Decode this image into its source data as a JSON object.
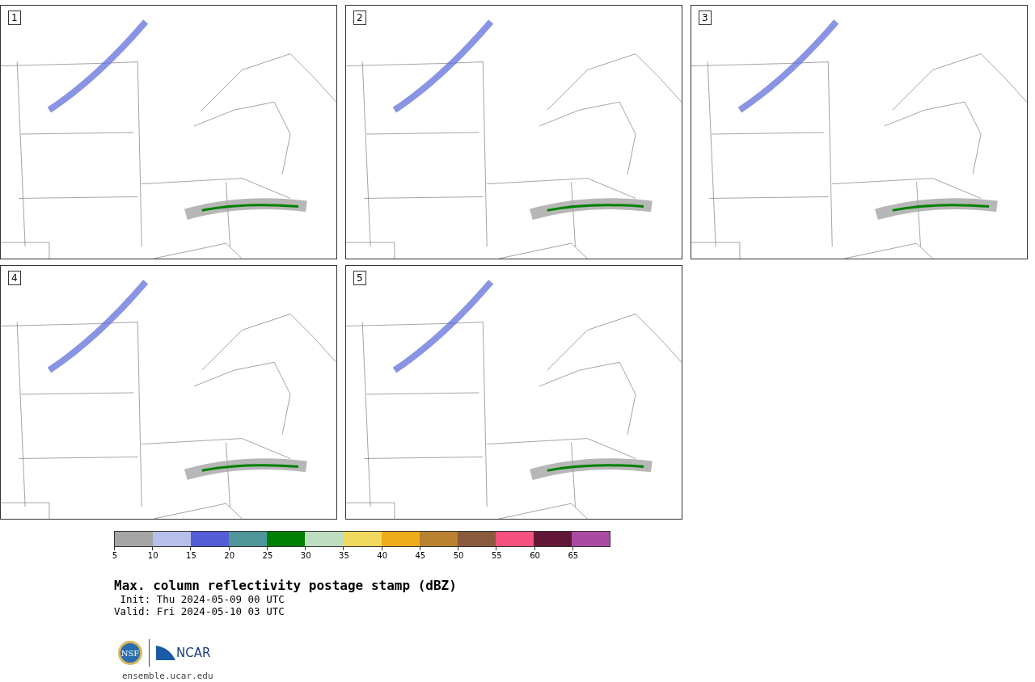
{
  "panels": [
    {
      "label": "1"
    },
    {
      "label": "2"
    },
    {
      "label": "3"
    },
    {
      "label": "4"
    },
    {
      "label": "5"
    }
  ],
  "colorbar": {
    "segments": [
      {
        "color": "#a5a5a5"
      },
      {
        "color": "#b7c0ea"
      },
      {
        "color": "#525dd6"
      },
      {
        "color": "#4f969b"
      },
      {
        "color": "#008000"
      },
      {
        "color": "#bfddbf"
      },
      {
        "color": "#efd95f"
      },
      {
        "color": "#eeac1a"
      },
      {
        "color": "#b98231"
      },
      {
        "color": "#8a5a3d"
      },
      {
        "color": "#f45181"
      },
      {
        "color": "#631736"
      },
      {
        "color": "#ab4aa3"
      }
    ],
    "ticks": [
      "5",
      "10",
      "15",
      "20",
      "25",
      "30",
      "35",
      "40",
      "45",
      "50",
      "55",
      "60",
      "65"
    ]
  },
  "title": "Max. column reflectivity postage stamp (dBZ)",
  "init": " Init: Thu 2024-05-09 00 UTC",
  "valid": "Valid: Fri 2024-05-10 03 UTC",
  "logos": {
    "nsf": "NSF",
    "ncar": "NCAR"
  },
  "footer": "ensemble.ucar.edu"
}
